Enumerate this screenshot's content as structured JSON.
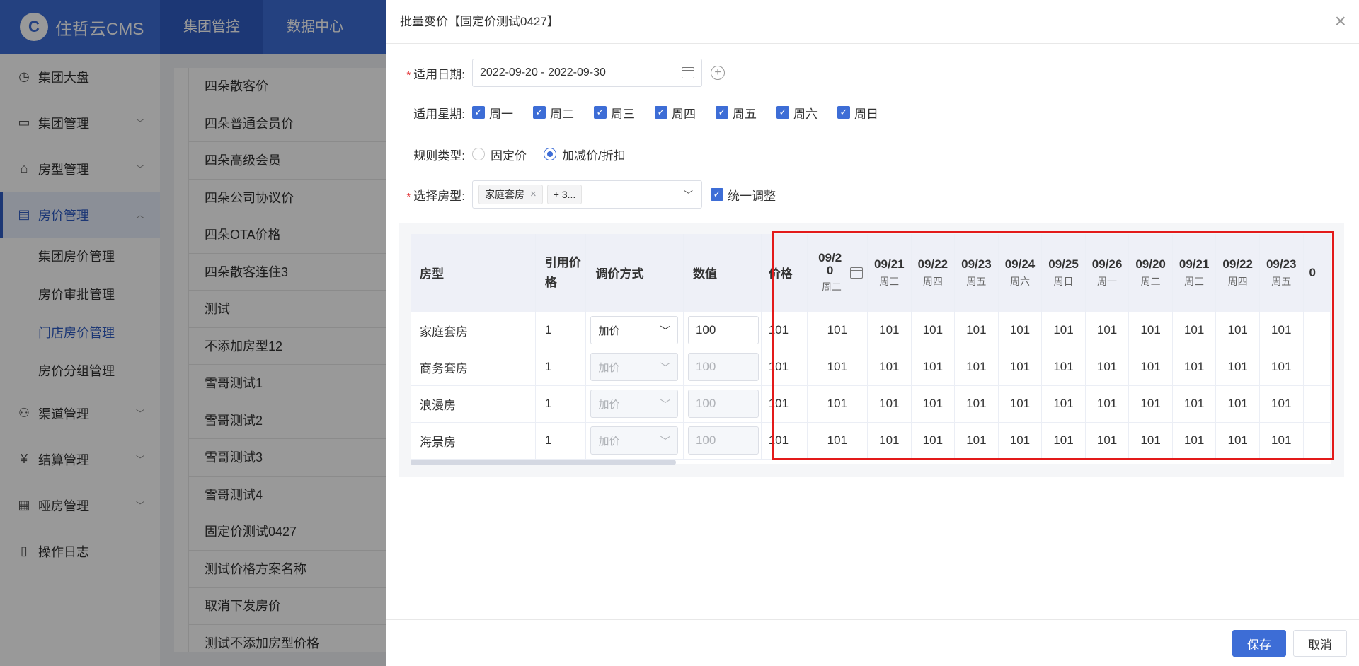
{
  "app": {
    "logo": "住哲云CMS"
  },
  "topnav": [
    {
      "label": "集团管控"
    },
    {
      "label": "数据中心"
    }
  ],
  "sidebar": {
    "items": [
      {
        "label": "集团大盘",
        "icon": "dashboard-icon"
      },
      {
        "label": "集团管理",
        "icon": "monitor-icon"
      },
      {
        "label": "房型管理",
        "icon": "house-icon"
      },
      {
        "label": "房价管理",
        "icon": "price-icon"
      },
      {
        "label": "渠道管理",
        "icon": "channel-icon"
      },
      {
        "label": "结算管理",
        "icon": "yen-icon"
      },
      {
        "label": "哑房管理",
        "icon": "document-icon"
      },
      {
        "label": "操作日志",
        "icon": "log-icon"
      }
    ],
    "subitems": [
      "集团房价管理",
      "房价审批管理",
      "门店房价管理",
      "房价分组管理"
    ]
  },
  "plan_list": [
    "四朵散客价",
    "四朵普通会员价",
    "四朵高级会员",
    "四朵公司协议价",
    "四朵OTA价格",
    "四朵散客连住3",
    "测试",
    "不添加房型12",
    "雪哥测试1",
    "雪哥测试2",
    "雪哥测试3",
    "雪哥测试4",
    "固定价测试0427",
    "测试价格方案名称",
    "取消下发房价",
    "测试不添加房型价格"
  ],
  "drawer": {
    "title": "批量变价【固定价测试0427】",
    "date_label": "适用日期:",
    "date_range": "2022-09-20 - 2022-09-30",
    "weekday_label": "适用星期:",
    "weekdays": [
      "周一",
      "周二",
      "周三",
      "周四",
      "周五",
      "周六",
      "周日"
    ],
    "rule_label": "规则类型:",
    "rule_options": [
      "固定价",
      "加减价/折扣"
    ],
    "room_label": "选择房型:",
    "room_tag": "家庭套房",
    "room_more": "+ 3...",
    "unify_label": "统一调整",
    "save": "保存",
    "cancel": "取消"
  },
  "table": {
    "headers": {
      "room": "房型",
      "ref": "引用价格",
      "method": "调价方式",
      "value": "数值",
      "price": "价格"
    },
    "dates": [
      {
        "d": "09/20",
        "w": "周二"
      },
      {
        "d": "09/21",
        "w": "周三"
      },
      {
        "d": "09/22",
        "w": "周四"
      },
      {
        "d": "09/23",
        "w": "周五"
      },
      {
        "d": "09/24",
        "w": "周六"
      },
      {
        "d": "09/25",
        "w": "周日"
      },
      {
        "d": "09/26",
        "w": "周一"
      },
      {
        "d": "09/20",
        "w": "周二"
      },
      {
        "d": "09/21",
        "w": "周三"
      },
      {
        "d": "09/22",
        "w": "周四"
      },
      {
        "d": "09/23",
        "w": "周五"
      }
    ],
    "partial_date": "0",
    "rows": [
      {
        "room": "家庭套房",
        "ref": "1",
        "method": "加价",
        "value": "100",
        "price": "101",
        "day_prices": [
          "101",
          "101",
          "101",
          "101",
          "101",
          "101",
          "101",
          "101",
          "101",
          "101",
          "101"
        ]
      },
      {
        "room": "商务套房",
        "ref": "1",
        "method": "加价",
        "value": "100",
        "price": "101",
        "day_prices": [
          "101",
          "101",
          "101",
          "101",
          "101",
          "101",
          "101",
          "101",
          "101",
          "101",
          "101"
        ]
      },
      {
        "room": "浪漫房",
        "ref": "1",
        "method": "加价",
        "value": "100",
        "price": "101",
        "day_prices": [
          "101",
          "101",
          "101",
          "101",
          "101",
          "101",
          "101",
          "101",
          "101",
          "101",
          "101"
        ]
      },
      {
        "room": "海景房",
        "ref": "1",
        "method": "加价",
        "value": "100",
        "price": "101",
        "day_prices": [
          "101",
          "101",
          "101",
          "101",
          "101",
          "101",
          "101",
          "101",
          "101",
          "101",
          "101"
        ]
      }
    ]
  },
  "colors": {
    "primary": "#3d6dd6",
    "highlight": "#e31a1a"
  }
}
